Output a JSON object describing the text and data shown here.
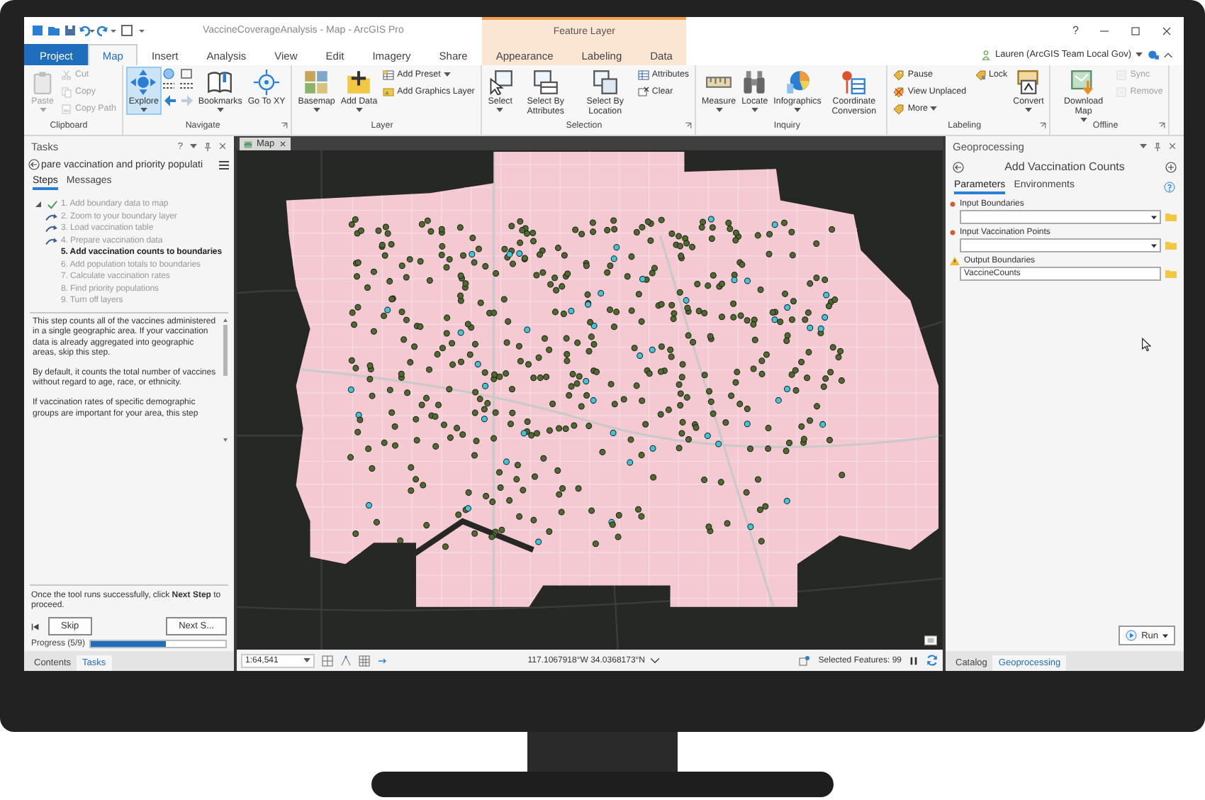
{
  "window": {
    "title": "VaccineCoverageAnalysis - Map - ArcGIS Pro",
    "contextual_group": "Feature Layer",
    "help": "?"
  },
  "tabs": [
    {
      "label": "Project",
      "kind": "backstage",
      "selected": false
    },
    {
      "label": "Map",
      "kind": "core",
      "selected": true
    },
    {
      "label": "Insert",
      "kind": "core",
      "selected": false
    },
    {
      "label": "Analysis",
      "kind": "core",
      "selected": false
    },
    {
      "label": "View",
      "kind": "core",
      "selected": false
    },
    {
      "label": "Edit",
      "kind": "core",
      "selected": false
    },
    {
      "label": "Imagery",
      "kind": "core",
      "selected": false
    },
    {
      "label": "Share",
      "kind": "core",
      "selected": false
    },
    {
      "label": "Appearance",
      "kind": "contextual",
      "selected": false
    },
    {
      "label": "Labeling",
      "kind": "contextual",
      "selected": false
    },
    {
      "label": "Data",
      "kind": "contextual",
      "selected": false
    }
  ],
  "user": {
    "name": "Lauren (ArcGIS Team Local Gov)"
  },
  "ribbon_groups": [
    {
      "label": "Clipboard",
      "launcher": false,
      "buttons": [
        {
          "label": "Paste",
          "kind": "large",
          "disabled": true,
          "active": false,
          "dropdown": true
        },
        {
          "label": "Cut",
          "kind": "small",
          "disabled": true,
          "active": false,
          "dropdown": false
        },
        {
          "label": "Copy",
          "kind": "small",
          "disabled": true,
          "active": false,
          "dropdown": false
        },
        {
          "label": "Copy Path",
          "kind": "small",
          "disabled": true,
          "active": false,
          "dropdown": false
        }
      ]
    },
    {
      "label": "Navigate",
      "launcher": true,
      "buttons": [
        {
          "label": "Explore",
          "kind": "large",
          "disabled": false,
          "active": true,
          "dropdown": true
        },
        {
          "label": "Bookmarks",
          "kind": "large",
          "disabled": false,
          "active": false,
          "dropdown": true
        },
        {
          "label": "Go To XY",
          "kind": "large",
          "disabled": false,
          "active": false,
          "dropdown": false
        }
      ]
    },
    {
      "label": "Layer",
      "launcher": false,
      "buttons": [
        {
          "label": "Basemap",
          "kind": "large",
          "disabled": false,
          "active": false,
          "dropdown": true
        },
        {
          "label": "Add Data",
          "kind": "large",
          "disabled": false,
          "active": false,
          "dropdown": true
        },
        {
          "label": "Add Preset",
          "kind": "small",
          "disabled": false,
          "active": false,
          "dropdown": true
        },
        {
          "label": "Add Graphics Layer",
          "kind": "small",
          "disabled": false,
          "active": false,
          "dropdown": false
        }
      ]
    },
    {
      "label": "Selection",
      "launcher": true,
      "buttons": [
        {
          "label": "Select",
          "kind": "large",
          "disabled": false,
          "active": false,
          "dropdown": true
        },
        {
          "label": "Select By Attributes",
          "kind": "large",
          "disabled": false,
          "active": false,
          "dropdown": false
        },
        {
          "label": "Select By Location",
          "kind": "large",
          "disabled": false,
          "active": false,
          "dropdown": false
        },
        {
          "label": "Attributes",
          "kind": "small",
          "disabled": false,
          "active": false,
          "dropdown": false
        },
        {
          "label": "Clear",
          "kind": "small",
          "disabled": false,
          "active": false,
          "dropdown": false
        }
      ]
    },
    {
      "label": "Inquiry",
      "launcher": false,
      "buttons": [
        {
          "label": "Measure",
          "kind": "large",
          "disabled": false,
          "active": false,
          "dropdown": true
        },
        {
          "label": "Locate",
          "kind": "large",
          "disabled": false,
          "active": false,
          "dropdown": true
        },
        {
          "label": "Infographics",
          "kind": "large",
          "disabled": false,
          "active": false,
          "dropdown": true
        },
        {
          "label": "Coordinate Conversion",
          "kind": "large",
          "disabled": false,
          "active": false,
          "dropdown": false
        }
      ]
    },
    {
      "label": "Labeling",
      "launcher": true,
      "buttons": [
        {
          "label": "Pause",
          "kind": "small",
          "disabled": false,
          "active": false,
          "dropdown": false
        },
        {
          "label": "View Unplaced",
          "kind": "small",
          "disabled": false,
          "active": false,
          "dropdown": false
        },
        {
          "label": "More",
          "kind": "small",
          "disabled": false,
          "active": false,
          "dropdown": true
        },
        {
          "label": "Lock",
          "kind": "small",
          "disabled": false,
          "active": false,
          "dropdown": false
        },
        {
          "label": "Convert",
          "kind": "large",
          "disabled": false,
          "active": false,
          "dropdown": true
        }
      ]
    },
    {
      "label": "Offline",
      "launcher": true,
      "buttons": [
        {
          "label": "Download Map",
          "kind": "large",
          "disabled": false,
          "active": false,
          "dropdown": true
        },
        {
          "label": "Sync",
          "kind": "small",
          "disabled": true,
          "active": false,
          "dropdown": false
        },
        {
          "label": "Remove",
          "kind": "small",
          "disabled": true,
          "active": false,
          "dropdown": false
        }
      ]
    }
  ],
  "tasks_pane": {
    "title": "Tasks",
    "task_name": "pare vaccination and priority populati",
    "tabs": [
      {
        "label": "Steps",
        "selected": true
      },
      {
        "label": "Messages",
        "selected": false
      }
    ],
    "step_group": {
      "expanded": true,
      "children": [
        {
          "label": "1. Add boundary data to map",
          "kind": "done"
        },
        {
          "label": "2. Zoom to your boundary layer",
          "kind": "auto"
        },
        {
          "label": "3. Load vaccination table",
          "kind": "auto"
        },
        {
          "label": "4. Prepare vaccination data",
          "kind": "auto"
        },
        {
          "label": "5. Add vaccination counts to boundaries",
          "kind": "current"
        },
        {
          "label": "6. Add population totals to boundaries",
          "kind": "pending"
        },
        {
          "label": "7. Calculate vaccination rates",
          "kind": "pending"
        },
        {
          "label": "8. Find priority populations",
          "kind": "pending"
        },
        {
          "label": "9. Turn off layers",
          "kind": "pending"
        }
      ]
    },
    "description": [
      "This step counts all of the vaccines administered in a single geographic area. If your vaccination data is already aggregated into geographic areas, skip this step.",
      "By default, it counts the total number of vaccines without regard to age, race, or ethnicity.",
      "If vaccination rates of specific demographic groups are important for your area, this step"
    ],
    "instruction": "Once the tool runs successfully, click **Next Step** to proceed.",
    "buttons": [
      {
        "label": "Skip"
      },
      {
        "label": "Next S..."
      }
    ],
    "progress": {
      "label": "Progress (5/9)",
      "level": 0.56
    },
    "dock_tabs": [
      {
        "label": "Contents",
        "selected": false
      },
      {
        "label": "Tasks",
        "selected": true
      }
    ]
  },
  "map_view": {
    "tab": "Map",
    "scale": "1:64,541",
    "coordinates": "117.1067918°W 34.0368173°N",
    "selection": "Selected Features: 99"
  },
  "geoprocessing_pane": {
    "title": "Geoprocessing",
    "tool": "Add Vaccination Counts",
    "tabs": [
      {
        "label": "Parameters",
        "selected": true
      },
      {
        "label": "Environments",
        "selected": false
      }
    ],
    "parameters": [
      {
        "label": "Input Boundaries",
        "required": true,
        "warning": false,
        "kind": "dropdown"
      },
      {
        "label": "Input Vaccination Points",
        "required": true,
        "warning": false,
        "kind": "dropdown"
      },
      {
        "label": "Output Boundaries",
        "required": false,
        "warning": true,
        "kind": "text",
        "value": "VaccineCounts"
      }
    ],
    "run_button": "Run",
    "dock_tabs": [
      {
        "label": "Catalog",
        "selected": false
      },
      {
        "label": "Geoprocessing",
        "selected": true
      }
    ]
  }
}
